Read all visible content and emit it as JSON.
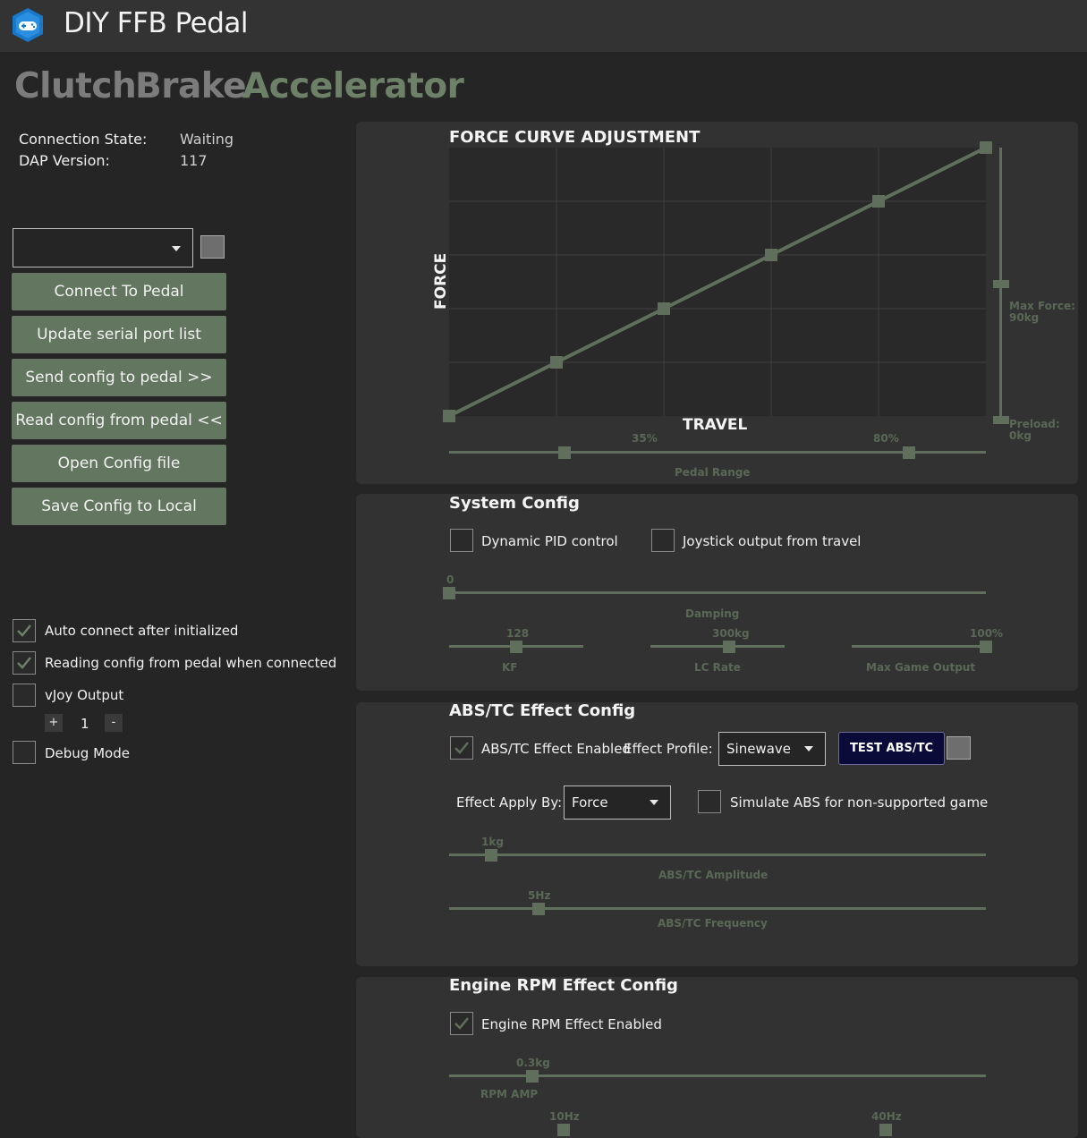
{
  "app": {
    "title": "DIY FFB Pedal"
  },
  "tabs": [
    {
      "label": "Clutch",
      "color": "#7c7c7c"
    },
    {
      "label": "Brake",
      "color": "#7c7c7c"
    },
    {
      "label": "Accelerator",
      "color": "#6d8168"
    }
  ],
  "connection": {
    "state_label": "Connection State:",
    "state_value": "Waiting",
    "dap_label": "DAP Version:",
    "dap_value": "117"
  },
  "port_select": {
    "value": ""
  },
  "buttons": {
    "connect": "Connect To Pedal",
    "update_ports": "Update serial port list",
    "send_config": "Send config to pedal >>",
    "read_config": "Read config from pedal <<",
    "open_config": "Open Config file",
    "save_config": "Save Config to Local"
  },
  "options": {
    "auto_connect": {
      "label": "Auto connect after initialized",
      "checked": true
    },
    "read_on_connect": {
      "label": "Reading config from pedal when connected",
      "checked": true
    },
    "vjoy": {
      "label": "vJoy Output",
      "checked": false
    },
    "vjoy_stepper": {
      "plus": "+",
      "value": "1",
      "minus": "-"
    },
    "debug": {
      "label": "Debug Mode",
      "checked": false
    }
  },
  "force_curve": {
    "title": "FORCE CURVE ADJUSTMENT",
    "y_axis_label": "FORCE",
    "x_axis_label": "TRAVEL",
    "points": [
      0,
      20,
      40,
      60,
      80,
      100
    ],
    "max_force_label": "Max Force:",
    "max_force_value": "90kg",
    "max_force_level": 0.5,
    "preload_label": "Preload:",
    "preload_value": "0kg",
    "preload_level": 0,
    "pedal_range": {
      "label": "Pedal Range",
      "min_label": "35%",
      "max_label": "80%",
      "min": 35,
      "max": 80
    }
  },
  "system_config": {
    "title": "System Config",
    "dynamic_pid": {
      "label": "Dynamic PID control",
      "checked": false
    },
    "joystick_travel": {
      "label": "Joystick output from travel",
      "checked": false
    },
    "damping": {
      "label": "Damping",
      "value_label": "0",
      "fraction": 0
    },
    "kf": {
      "label": "KF",
      "value_label": "128",
      "fraction": 0.5
    },
    "lc_rate": {
      "label": "LC Rate",
      "value_label": "300kg",
      "fraction": 0.59
    },
    "max_game_output": {
      "label": "Max Game Output",
      "value_label": "100%",
      "fraction": 1.0
    }
  },
  "abs_config": {
    "title": "ABS/TC Effect Config",
    "enabled": {
      "label": "ABS/TC Effect Enabled",
      "checked": true
    },
    "profile_label": "Effect Profile:",
    "profile_value": "Sinewave",
    "test_button": "TEST ABS/TC",
    "apply_label": "Effect Apply By:",
    "apply_value": "Force",
    "simulate": {
      "label": "Simulate ABS for non-supported game",
      "checked": false
    },
    "amplitude": {
      "label": "ABS/TC Amplitude",
      "value_label": "1kg",
      "fraction": 0.078
    },
    "frequency": {
      "label": "ABS/TC Frequency",
      "value_label": "5Hz",
      "fraction": 0.167
    }
  },
  "rpm_config": {
    "title": "Engine RPM Effect Config",
    "enabled": {
      "label": "Engine RPM Effect Enabled",
      "checked": true
    },
    "amp": {
      "label": "RPM AMP",
      "value_label": "0.3kg",
      "fraction": 0.155
    },
    "freq_min_label": "10Hz",
    "freq_max_label": "40Hz"
  },
  "colors": {
    "accent": "#637660",
    "curve": "#5f6f5c",
    "test_button": "#0b0b3a"
  }
}
